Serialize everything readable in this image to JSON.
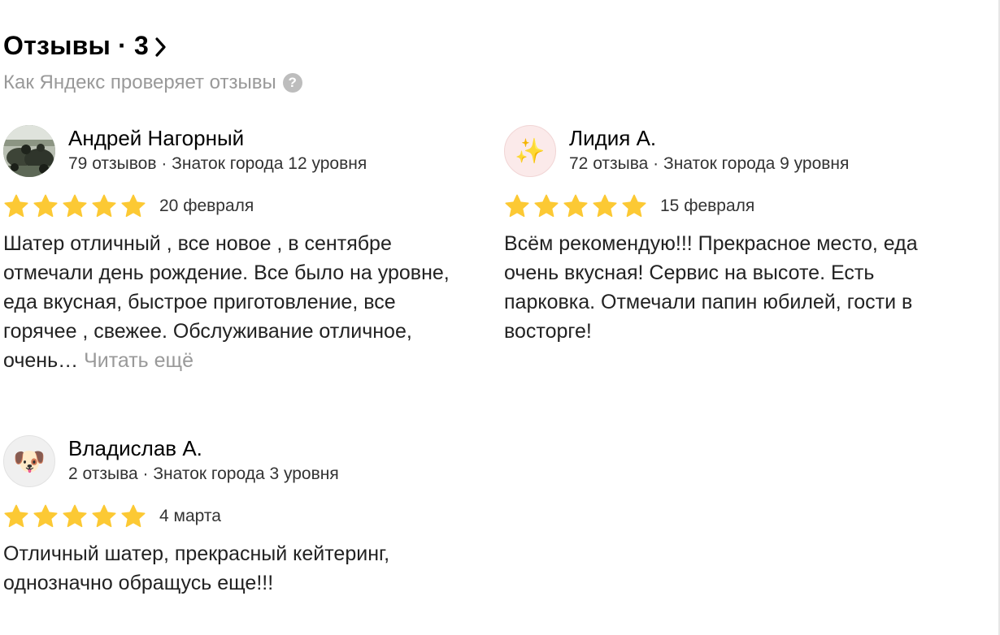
{
  "header": {
    "title": "Отзывы · 3",
    "verify_link": "Как Яндекс проверяет отзывы"
  },
  "colors": {
    "star": "#fcc934",
    "muted": "#999999",
    "text": "#222222"
  },
  "reviews": [
    {
      "author": "Андрей Нагорный",
      "meta": "79 отзывов · Знаток города 12 уровня",
      "rating": 5,
      "date": "20 февраля",
      "text": "Шатер отличный , все новое , в сентябре отмечали день рождение. Все было на уровне, еда вкусная, быстрое приготовление, все горячее , свежее. Обслуживание отличное, очень…",
      "read_more": "Читать ещё",
      "avatar": "photo"
    },
    {
      "author": "Лидия А.",
      "meta": "72 отзыва · Знаток города 9 уровня",
      "rating": 5,
      "date": "15 февраля",
      "text": "Всём рекомендую!!! Прекрасное место, еда очень вкусная! Сервис на высоте. Есть парковка. Отмечали папин юбилей, гости в восторге!",
      "avatar": "✨"
    },
    {
      "author": "Владислав А.",
      "meta": "2 отзыва · Знаток города 3 уровня",
      "rating": 5,
      "date": "4 марта",
      "text": "Отличный шатер, прекрасный кейтеринг, однозначно обращусь еще!!!",
      "avatar": "🐶"
    }
  ]
}
